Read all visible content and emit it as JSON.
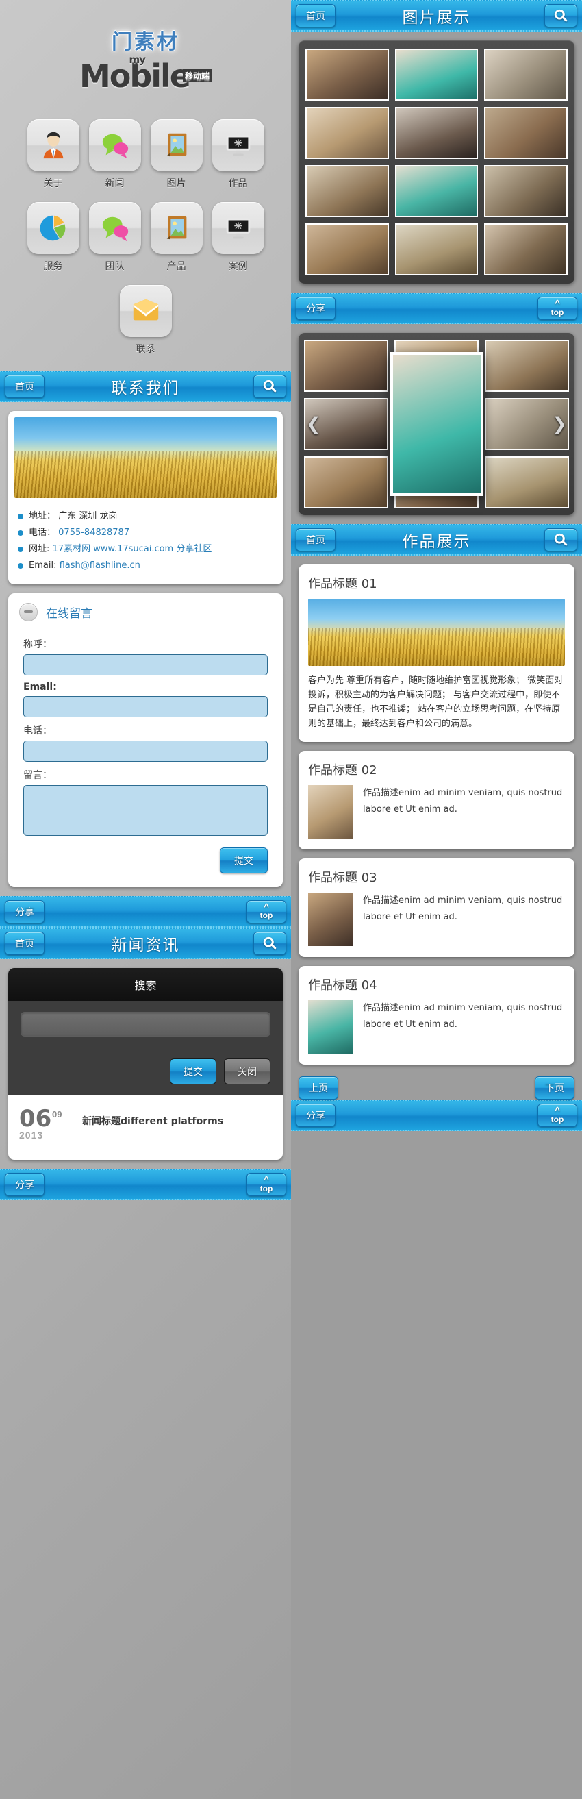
{
  "logo": {
    "cn": "门素材",
    "my": "my",
    "main": "Mobile",
    "tag": "移动端"
  },
  "home_grid": [
    {
      "label": "关于",
      "icon": "user-icon"
    },
    {
      "label": "新闻",
      "icon": "chat-bubbles-icon"
    },
    {
      "label": "图片",
      "icon": "photo-frame-icon"
    },
    {
      "label": "作品",
      "icon": "monitor-icon"
    },
    {
      "label": "服务",
      "icon": "pie-chart-icon"
    },
    {
      "label": "团队",
      "icon": "chat-bubbles-icon"
    },
    {
      "label": "产品",
      "icon": "photo-frame-icon"
    },
    {
      "label": "案例",
      "icon": "monitor-icon"
    },
    {
      "label": "联系",
      "icon": "envelope-icon"
    }
  ],
  "bars": {
    "home_label": "首页",
    "share_label": "分享",
    "top_label": "top",
    "gallery_title": "图片展示",
    "contact_title": "联系我们",
    "works_title": "作品展示",
    "news_title": "新闻资讯"
  },
  "contact": {
    "items": [
      {
        "label": "地址：",
        "value": "广东 深圳 龙岗",
        "link": false
      },
      {
        "label": "电话：",
        "value": "0755-84828787",
        "link": true
      },
      {
        "label": "网址:",
        "value": "17素材网 www.17sucai.com 分享社区",
        "link": true
      },
      {
        "label": "Email:",
        "value": "flash@flashline.cn",
        "link": true
      }
    ]
  },
  "message_form": {
    "heading": "在线留言",
    "collapse_icon": "minus-icon",
    "fields": [
      {
        "label": "称呼：",
        "value": "",
        "bold": false,
        "type": "text"
      },
      {
        "label": "Email:",
        "value": "",
        "bold": true,
        "type": "text"
      },
      {
        "label": "电话：",
        "value": "",
        "bold": false,
        "type": "text"
      },
      {
        "label": "留言：",
        "value": "",
        "bold": false,
        "type": "textarea"
      }
    ],
    "submit_label": "提交"
  },
  "search_dialog": {
    "title": "搜索",
    "input_value": "",
    "submit_label": "提交",
    "close_label": "关闭"
  },
  "news": {
    "day": "06",
    "month": "09",
    "year": "2013",
    "title": "新闻标题different platforms"
  },
  "carousel": {
    "prev_icon": "chevron-left-icon",
    "next_icon": "chevron-right-icon"
  },
  "works": [
    {
      "title": "作品标题 01",
      "has_banner": true,
      "body": "客户为先 尊重所有客户，随时随地维护富图视觉形象； 微笑面对投诉，积极主动的为客户解决问题； 与客户交流过程中，即使不是自己的责任，也不推诿； 站在客户的立场思考问题，在坚持原则的基础上，最终达到客户和公司的满意。"
    },
    {
      "title": "作品标题 02",
      "has_banner": false,
      "body": "作品描述enim ad minim veniam, quis nostrud labore et Ut enim ad."
    },
    {
      "title": "作品标题 03",
      "has_banner": false,
      "body": "作品描述enim ad minim veniam, quis nostrud labore et Ut enim ad."
    },
    {
      "title": "作品标题 04",
      "has_banner": false,
      "body": "作品描述enim ad minim veniam, quis nostrud labore et Ut enim ad."
    }
  ],
  "pager": {
    "prev_label": "上页",
    "next_label": "下页"
  },
  "colors": {
    "accent": "#1f9ada",
    "bar_light": "#34b6e8",
    "link": "#2a7fb8",
    "dark_panel": "#3d3d3d"
  }
}
